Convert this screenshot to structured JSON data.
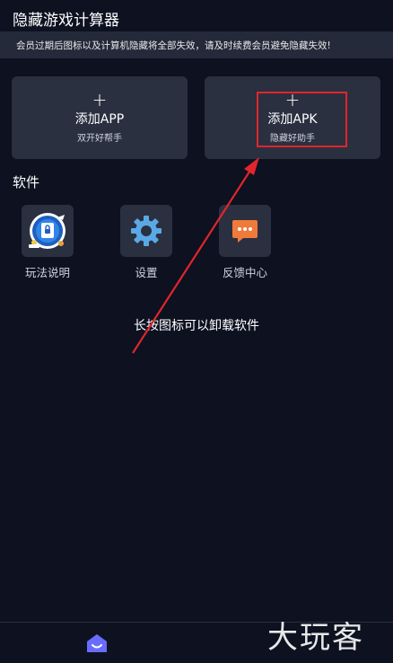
{
  "header": {
    "title": "隐藏游戏计算器"
  },
  "notice": {
    "text": "会员过期后图标以及计算机隐藏将全部失效，请及时续费会员避免隐藏失效!"
  },
  "actions": {
    "add_app": {
      "plus": "+",
      "title": "添加APP",
      "subtitle": "双开好帮手"
    },
    "add_apk": {
      "plus": "+",
      "title": "添加APK",
      "subtitle": "隐藏好助手"
    }
  },
  "software": {
    "section_label": "软件",
    "items": [
      {
        "label": "玩法说明",
        "icon": "guide-icon"
      },
      {
        "label": "设置",
        "icon": "gear-icon"
      },
      {
        "label": "反馈中心",
        "icon": "feedback-icon"
      }
    ]
  },
  "hint": {
    "text": "长按图标可以卸载软件"
  },
  "annotation": {
    "highlight_color": "#e0262b",
    "arrow_color": "#e0262b"
  },
  "bottom_nav": {
    "home_icon": "home-icon",
    "active_color": "#6a6cff"
  },
  "watermark": {
    "text": "大玩客"
  }
}
